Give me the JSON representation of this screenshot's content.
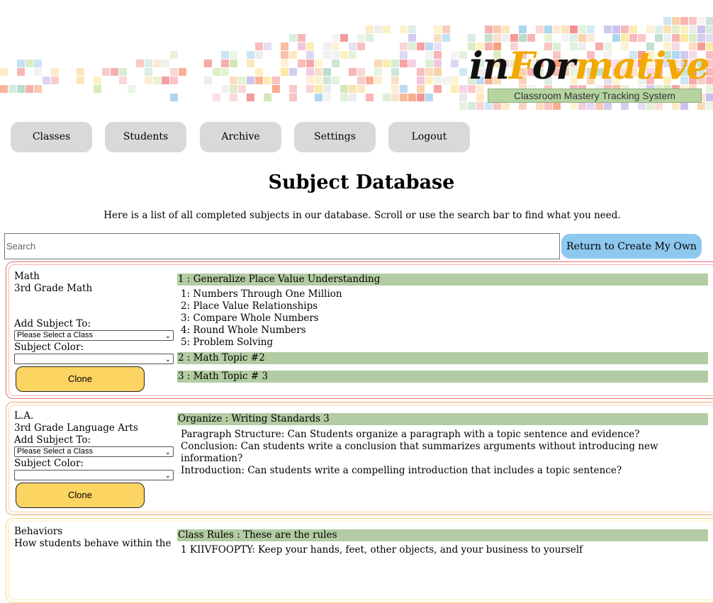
{
  "brand": {
    "logo_prefix": "in",
    "logo_f": "F",
    "logo_mid": "or",
    "logo_suffix": "mative",
    "tagline": "Classroom Mastery Tracking System"
  },
  "nav": [
    "Classes",
    "Students",
    "Archive",
    "Settings",
    "Logout"
  ],
  "page": {
    "title": "Subject Database",
    "intro": "Here is a list of all completed subjects in our database. Scroll or use the search bar to find what you need."
  },
  "search": {
    "placeholder": "Search"
  },
  "return_button": "Return to Create My Own",
  "labels": {
    "add_subject_to": "Add Subject To:",
    "subject_color": "Subject Color:",
    "select_class": "Please Select a Class",
    "clone": "Clone"
  },
  "subjects": [
    {
      "name": "Math",
      "description": "3rd Grade Math",
      "border_color": "#e87070",
      "inner_border_color": "#f3b5b5",
      "topics": [
        {
          "title": "1 : Generalize Place Value Understanding",
          "standards": [
            "1: Numbers Through One Million",
            "2: Place Value Relationships",
            "3: Compare Whole Numbers",
            "4: Round Whole Numbers",
            "5: Problem Solving"
          ]
        },
        {
          "title": "2 : Math Topic #2",
          "standards": []
        },
        {
          "title": "3 : Math Topic # 3",
          "standards": []
        }
      ]
    },
    {
      "name": "L.A.",
      "description": "3rd Grade Language Arts",
      "border_color": "#f0a870",
      "inner_border_color": "#f8d2b0",
      "topics": [
        {
          "title": "Organize : Writing Standards 3",
          "standards": [
            "Paragraph Structure: Can Students organize a paragraph with a topic sentence and evidence?",
            "Conclusion: Can students write a conclusion that summarizes arguments without introducing new information?",
            "Introduction: Can students write a compelling introduction that includes a topic sentence?"
          ]
        }
      ]
    },
    {
      "name": "Behaviors",
      "description": "How students behave within the",
      "border_color": "#f5dc70",
      "inner_border_color": "#faedb5",
      "topics": [
        {
          "title": "Class Rules : These are the rules",
          "standards": [
            "1 KIIVFOOPTY: Keep your hands, feet, other objects, and your business to yourself"
          ]
        }
      ]
    }
  ]
}
